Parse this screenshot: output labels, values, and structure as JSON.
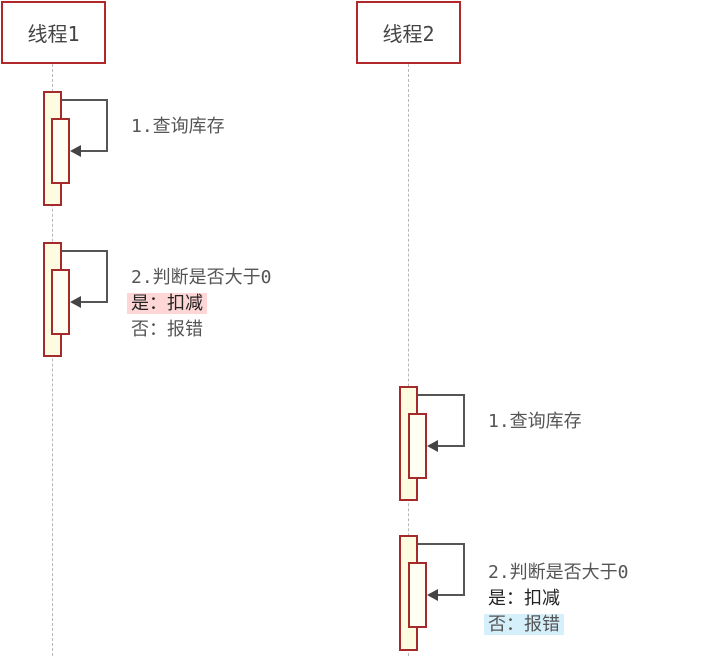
{
  "threads": [
    {
      "label": "线程1"
    },
    {
      "label": "线程2"
    }
  ],
  "t1_step1": {
    "text": "1.查询库存"
  },
  "t1_step2": {
    "lines": [
      "2.判断是否大于0",
      "是：扣减",
      "否：报错"
    ]
  },
  "t2_step1": {
    "text": "1.查询库存"
  },
  "t2_step2": {
    "lines": [
      "2.判断是否大于0",
      "是：扣减",
      "否：报错"
    ]
  },
  "colors": {
    "border": "#b0282a",
    "activation": "#fdfce0",
    "highlight_pink": "#ffd6d6",
    "highlight_blue": "#d6f0fb"
  }
}
